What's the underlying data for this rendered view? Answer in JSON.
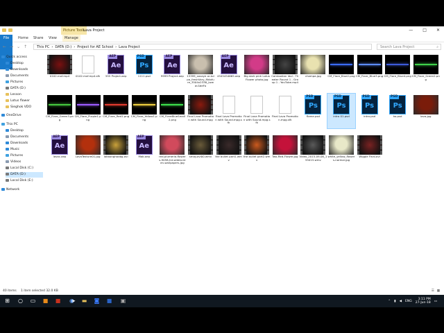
{
  "window": {
    "title": "Lava Project",
    "context_tab": "Picture Tools",
    "controls": {
      "minimize": "—",
      "maximize": "□",
      "close": "✕"
    }
  },
  "ribbon": {
    "tabs": [
      "File",
      "Home",
      "Share",
      "View",
      "Manage"
    ]
  },
  "address": {
    "crumbs": [
      "This PC",
      "DATA (D:)",
      "Project for AE School",
      "Lava Project"
    ],
    "separator": "›",
    "search_placeholder": "Search Lava Project"
  },
  "nav_pane": {
    "items": [
      {
        "label": "Quick access",
        "icon": "star-icon",
        "color": "#2f8ad8",
        "indent": 0
      },
      {
        "label": "Desktop",
        "icon": "desktop-icon",
        "color": "#2f8ad8",
        "indent": 1
      },
      {
        "label": "Downloads",
        "icon": "download-icon",
        "color": "#2f8ad8",
        "indent": 1
      },
      {
        "label": "Documents",
        "icon": "documents-icon",
        "color": "#8a9bb0",
        "indent": 1
      },
      {
        "label": "Pictures",
        "icon": "pictures-icon",
        "color": "#3fa1e0",
        "indent": 1
      },
      {
        "label": "DATA (D:)",
        "icon": "drive-icon",
        "color": "#7a7a7a",
        "indent": 1
      },
      {
        "label": "Lesson",
        "icon": "folder-icon",
        "color": "#e8c15b",
        "indent": 1
      },
      {
        "label": "Lotus flower",
        "icon": "folder-icon",
        "color": "#e8c15b",
        "indent": 1
      },
      {
        "label": "Sieghok VDO",
        "icon": "folder-icon",
        "color": "#e8c15b",
        "indent": 1
      },
      {
        "label": "OneDrive",
        "icon": "cloud-icon",
        "color": "#2f8ad8",
        "indent": 0
      },
      {
        "label": "This PC",
        "icon": "computer-icon",
        "color": "#3fa1e0",
        "indent": 0
      },
      {
        "label": "Desktop",
        "icon": "desktop-icon",
        "color": "#2f8ad8",
        "indent": 1
      },
      {
        "label": "Documents",
        "icon": "documents-icon",
        "color": "#8a9bb0",
        "indent": 1
      },
      {
        "label": "Downloads",
        "icon": "download-icon",
        "color": "#2f8ad8",
        "indent": 1
      },
      {
        "label": "Music",
        "icon": "music-icon",
        "color": "#2f8ad8",
        "indent": 1
      },
      {
        "label": "Pictures",
        "icon": "pictures-icon",
        "color": "#3fa1e0",
        "indent": 1
      },
      {
        "label": "Videos",
        "icon": "videos-icon",
        "color": "#8a9bb0",
        "indent": 1
      },
      {
        "label": "Local Disk (C:)",
        "icon": "drive-icon",
        "color": "#7a7a7a",
        "indent": 1
      },
      {
        "label": "DATA (D:)",
        "icon": "drive-icon",
        "color": "#7a7a7a",
        "indent": 1,
        "selected": true
      },
      {
        "label": "Local Disk (E:)",
        "icon": "drive-icon",
        "color": "#7a7a7a",
        "indent": 1
      },
      {
        "label": "Network",
        "icon": "network-icon",
        "color": "#2f8ad8",
        "indent": 0
      }
    ]
  },
  "files": [
    {
      "name": "0102.mxf.mp4",
      "kind": "video",
      "color": "#7a1010"
    },
    {
      "name": "0102.mxf.mp4.sfk",
      "kind": "blank"
    },
    {
      "name": "555 Project.aep",
      "kind": "aep"
    },
    {
      "name": "1111.psd",
      "kind": "psd"
    },
    {
      "name": "9999 Project.aep",
      "kind": "aep"
    },
    {
      "name": "13399_savaye or-tolpa_freshVary_fildofure_3504x2336_(www.GdeFo",
      "kind": "image",
      "color": "#c9bfae"
    },
    {
      "name": "4545454665.aep",
      "kind": "aep"
    },
    {
      "name": "Big dark pink Lotus Flower photo.jpg",
      "kind": "image",
      "color": "#d23b88"
    },
    {
      "name": "Cambodian Idol - Theater Round 1 - Group 1 - YouTube.mp4",
      "kind": "video",
      "color": "#444444"
    },
    {
      "name": "champa.jpg",
      "kind": "image",
      "color": "#e9e2b0"
    },
    {
      "name": "CM_Flare_Blue2.png",
      "kind": "flare",
      "color": "#3b6cff"
    },
    {
      "name": "CM_Flare_Blue3.png",
      "kind": "flare",
      "color": "#5d8cff"
    },
    {
      "name": "CM_Flare_Blue4.png",
      "kind": "flare",
      "color": "#3d5bd9"
    },
    {
      "name": "CM_Flare_Green2.png",
      "kind": "flare",
      "color": "#3fd24a"
    },
    {
      "name": "CM_Flare_Green3.png",
      "kind": "flare",
      "color": "#45c83e"
    },
    {
      "name": "CM_Flare_Purple1.png",
      "kind": "flare",
      "color": "#9d5cff"
    },
    {
      "name": "CM_Flare_Red1.png",
      "kind": "flare",
      "color": "#e23b2f"
    },
    {
      "name": "CM_Flare_Yellow1.png",
      "kind": "flare",
      "color": "#f0d040"
    },
    {
      "name": "CM_FlareBlueSmall2.png",
      "kind": "flare",
      "color": "#3de04c"
    },
    {
      "name": "Final Lava Promotion with Sound.mpg",
      "kind": "video",
      "color": "#8a1a0e"
    },
    {
      "name": "Final Lava Promotion with Sound.mpg.sfk",
      "kind": "blank"
    },
    {
      "name": "Final Lava Promotion with Sound.mpg.sfk",
      "kind": "blank"
    },
    {
      "name": "Final Lava Promotion.mpg.sfk",
      "kind": "blank"
    },
    {
      "name": "flame.psd",
      "kind": "psd"
    },
    {
      "name": "intro 01.psd",
      "kind": "psd",
      "selected": true
    },
    {
      "name": "intro.psd",
      "kind": "psd"
    },
    {
      "name": "ko.psd",
      "kind": "psd"
    },
    {
      "name": "lava.jpg",
      "kind": "image",
      "color": "#7a1c0a"
    },
    {
      "name": "lavac.aep",
      "kind": "aep"
    },
    {
      "name": "LavaTexture01.jpg",
      "kind": "image",
      "color": "#b3300d"
    },
    {
      "name": "lokbonghaabg.avi",
      "kind": "video",
      "color": "#c9a13a"
    },
    {
      "name": "Mab.aep",
      "kind": "aep"
    },
    {
      "name": "red-plumeria-flowers-9058-hd-widescreen-wallpapers.jpg",
      "kind": "image",
      "color": "#d14a5c"
    },
    {
      "name": "smay.avi00.wmv",
      "kind": "video",
      "color": "#6a5b3a"
    },
    {
      "name": "the bullet part1.wmv",
      "kind": "video",
      "color": "#3a2a2a"
    },
    {
      "name": "the bullet part2.wmv",
      "kind": "video",
      "color": "#cc5a1e"
    },
    {
      "name": "Two-Red-Flower.jpg",
      "kind": "image",
      "color": "#c4123a"
    },
    {
      "name": "Video_2015-09-08_155015.wmv",
      "kind": "video",
      "color": "#5a5a5a"
    },
    {
      "name": "white_yellow_flowers-normal.jpg",
      "kind": "image",
      "color": "#e8e8c8"
    },
    {
      "name": "Wiggle Final.avi",
      "kind": "video",
      "color": "#7a2222"
    }
  ],
  "status": {
    "count": "40 items",
    "selection": "1 item selected  32.0 KB",
    "views": [
      "☰",
      "▦"
    ]
  },
  "taskbar": {
    "apps": [
      {
        "name": "windows-start-icon",
        "glyph": "⊞",
        "color": "#ffffff"
      },
      {
        "name": "search-icon",
        "glyph": "○",
        "color": "#ffffff"
      },
      {
        "name": "task-view-icon",
        "glyph": "▭",
        "color": "#ffffff"
      },
      {
        "name": "app-orange-icon",
        "glyph": "■",
        "color": "#e88a1a"
      },
      {
        "name": "app-red-icon",
        "glyph": "■",
        "color": "#c8321e"
      },
      {
        "name": "chrome-icon",
        "glyph": "◉",
        "color": "#6ea8ff"
      },
      {
        "name": "file-explorer-icon",
        "glyph": "▬",
        "color": "#e8c15b"
      },
      {
        "name": "app-active-icon",
        "glyph": "◙",
        "color": "#3a7bff"
      },
      {
        "name": "app-blue-icon",
        "glyph": "■",
        "color": "#2a63c4"
      },
      {
        "name": "app-dark-icon",
        "glyph": "▣",
        "color": "#aaaaaa"
      }
    ],
    "tray": {
      "lang": "ENG",
      "time": "3:11 PM",
      "date": "27-Jun-18"
    }
  }
}
